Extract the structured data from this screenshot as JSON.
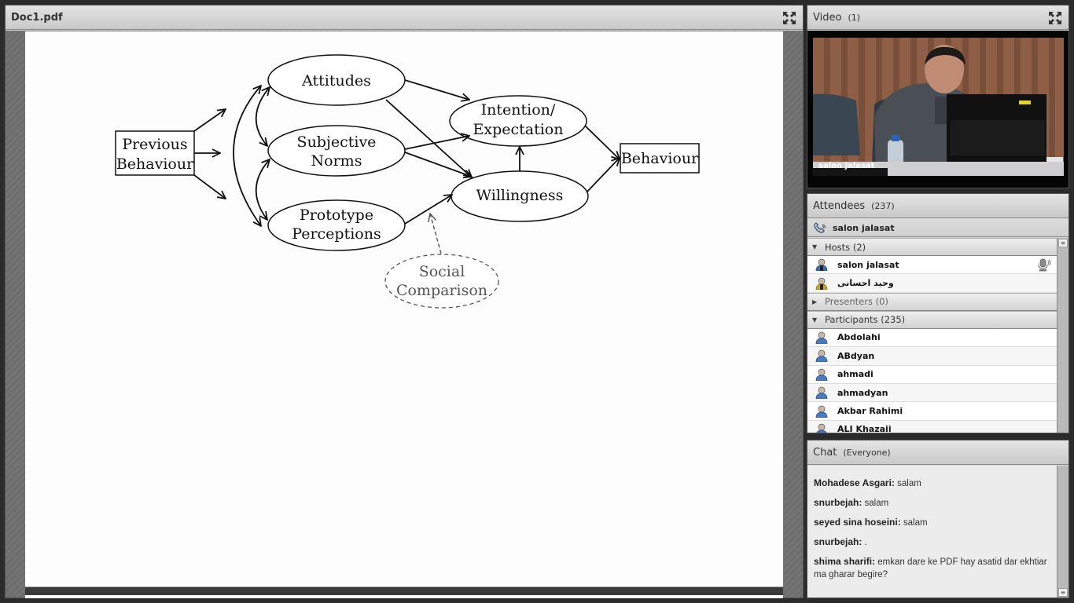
{
  "share_pod": {
    "title": "Doc1.pdf",
    "fullscreen_icon": "fullscreen-icon"
  },
  "diagram": {
    "nodes": {
      "previous_behaviour": [
        "Previous",
        "Behaviour"
      ],
      "attitudes": "Attitudes",
      "subjective_norms": [
        "Subjective",
        "Norms"
      ],
      "prototype_perceptions": [
        "Prototype",
        "Perceptions"
      ],
      "intention_expectation": [
        "Intention/",
        "Expectation"
      ],
      "willingness": "Willingness",
      "behaviour": "Behaviour",
      "social_comparison": [
        "Social",
        "Comparison"
      ]
    }
  },
  "video_pod": {
    "title": "Video",
    "count": "(1)",
    "camera_label": "salon jalasat",
    "fullscreen_icon": "fullscreen-icon"
  },
  "attendees_pod": {
    "title": "Attendees",
    "count": "(237)",
    "phone_user": "salon jalasat",
    "groups": {
      "hosts": {
        "label": "Hosts (2)",
        "expanded": true,
        "members": [
          {
            "name": "salon jalasat",
            "role": "host",
            "speaking": true
          },
          {
            "name": "وحید احسانی",
            "role": "host-alt",
            "speaking": false
          }
        ]
      },
      "presenters": {
        "label": "Presenters (0)",
        "expanded": false
      },
      "participants": {
        "label": "Participants (235)",
        "expanded": true,
        "members": [
          {
            "name": "Abdolahi"
          },
          {
            "name": "ABdyan"
          },
          {
            "name": "ahmadi"
          },
          {
            "name": "ahmadyan"
          },
          {
            "name": "Akbar Rahimi"
          },
          {
            "name": "ALI Khazaii"
          }
        ]
      }
    }
  },
  "chat_pod": {
    "title": "Chat",
    "scope": "(Everyone)",
    "messages": [
      {
        "sender": "Mohadese Asgari:",
        "text": " salam"
      },
      {
        "sender": "snurbejah:",
        "text": " salam"
      },
      {
        "sender": "seyed sina hoseini:",
        "text": " salam"
      },
      {
        "sender": "snurbejah:",
        "text": " ."
      },
      {
        "sender": "shima sharifi:",
        "text": " emkan dare ke PDF hay asatid dar ekhtiar ma gharar begire?"
      }
    ]
  },
  "colors": {
    "pod_header": "#d4d4d4",
    "background": "#2b2b2b",
    "host_avatar": "#3b6fb0",
    "host_alt_avatar": "#c9a227",
    "participant_avatar": "#4a7ac0"
  }
}
